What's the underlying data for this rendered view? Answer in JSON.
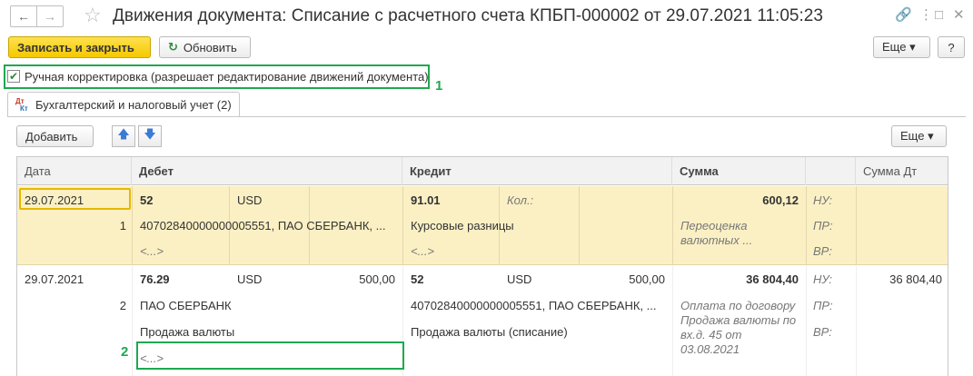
{
  "window": {
    "title": "Движения документа: Списание с расчетного счета КПБП-000002 от 29.07.2021 11:05:23",
    "nav_back": "←",
    "nav_forward": "→",
    "star": "☆",
    "link_icon": "🔗",
    "more_icon": "⋮",
    "maximize_icon": "□",
    "close_icon": "✕"
  },
  "toolbar": {
    "save_close": "Записать и закрыть",
    "refresh_icon": "↻",
    "refresh": "Обновить",
    "more": "Еще ▾",
    "help": "?"
  },
  "manual": {
    "checked": "✔",
    "label": "Ручная корректировка (разрешает редактирование движений документа)",
    "marker": "1"
  },
  "tab": {
    "dt": "Дт",
    "kt": "Кт",
    "label": "Бухгалтерский и налоговый учет (2)"
  },
  "grid_toolbar": {
    "add": "Добавить",
    "up": "🡅",
    "down": "🡇",
    "more": "Еще ▾"
  },
  "columns": {
    "date": "Дата",
    "debit": "Дебет",
    "credit": "Кредит",
    "sum": "Сумма",
    "sum_dt": "Сумма Дт"
  },
  "rows": [
    {
      "date": "29.07.2021",
      "num": "1",
      "debit_account": "52",
      "debit_currency": "USD",
      "debit_amount": "",
      "debit_sub1": "40702840000000005551, ПАО СБЕРБАНК, ...",
      "debit_sub2": "<...>",
      "debit_sub3": "",
      "credit_account": "91.01",
      "credit_qty_label": "Кол.:",
      "credit_currency": "",
      "credit_amount": "",
      "credit_sub1": "Курсовые разницы",
      "credit_sub2": "<...>",
      "sum": "600,12",
      "content": "Переоценка валютных ...",
      "nu": "НУ:",
      "pr": "ПР:",
      "vr": "ВР:",
      "sum_dt": ""
    },
    {
      "date": "29.07.2021",
      "num": "2",
      "debit_account": "76.29",
      "debit_currency": "USD",
      "debit_amount": "500,00",
      "debit_sub1": "ПАО СБЕРБАНК",
      "debit_sub2": "Продажа валюты",
      "debit_sub3": "<...>",
      "credit_account": "52",
      "credit_qty_label": "",
      "credit_currency": "USD",
      "credit_amount": "500,00",
      "credit_sub1": "40702840000000005551, ПАО СБЕРБАНК, ...",
      "credit_sub2": "Продажа валюты (списание)",
      "sum": "36 804,40",
      "content": "Оплата по договору Продажа валюты по вх.д. 45 от 03.08.2021",
      "nu": "НУ:",
      "pr": "ПР:",
      "vr": "ВР:",
      "sum_dt": "36 804,40"
    }
  ],
  "marker2": "2"
}
